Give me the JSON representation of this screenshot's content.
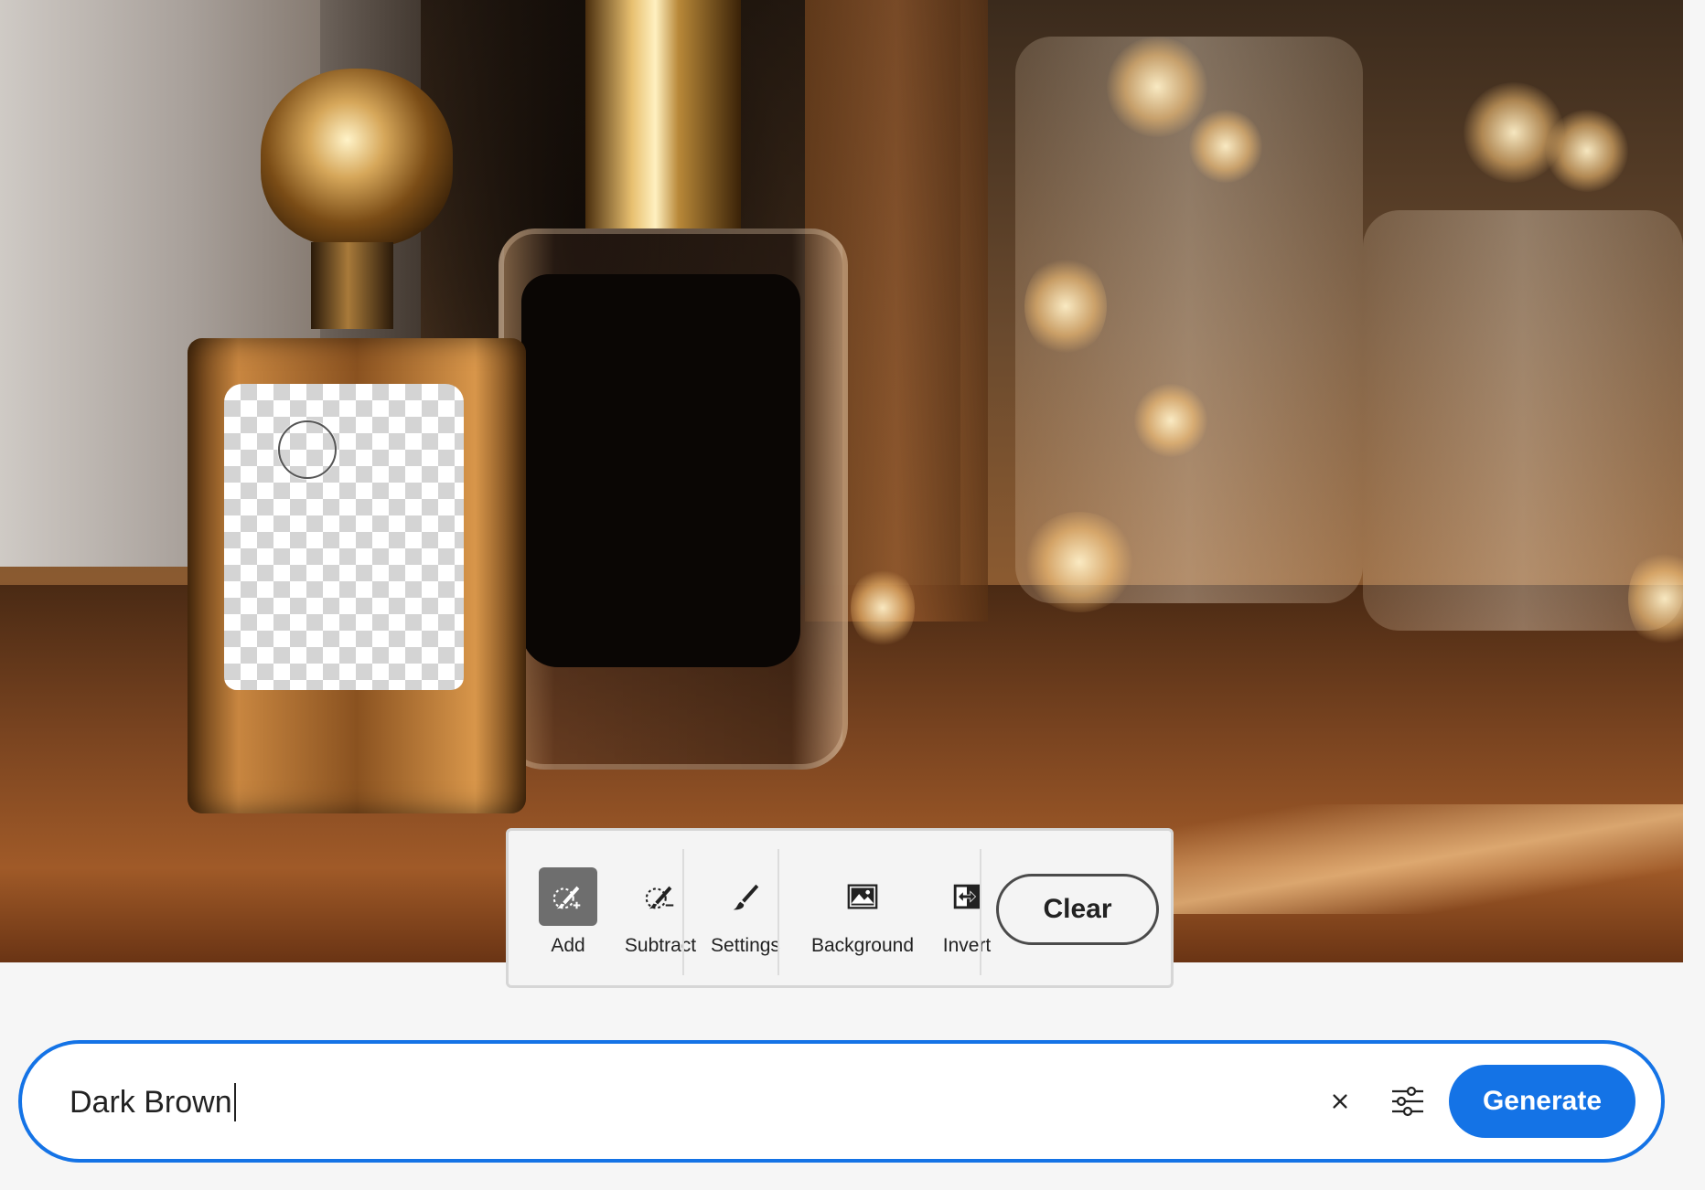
{
  "toolbar": {
    "tools": [
      {
        "label": "Add",
        "icon": "brush-add-icon",
        "active": true
      },
      {
        "label": "Subtract",
        "icon": "brush-subtract-icon",
        "active": false
      },
      {
        "label": "Settings",
        "icon": "brush-icon",
        "active": false
      },
      {
        "label": "Background",
        "icon": "image-icon",
        "active": false
      },
      {
        "label": "Invert",
        "icon": "invert-icon",
        "active": false
      }
    ],
    "clear_label": "Clear"
  },
  "prompt": {
    "value": "Dark Brown",
    "clear_icon": "close-icon",
    "settings_icon": "sliders-icon",
    "generate_label": "Generate"
  },
  "colors": {
    "accent": "#1473e6",
    "active_tool_bg": "#6e6e6e"
  }
}
